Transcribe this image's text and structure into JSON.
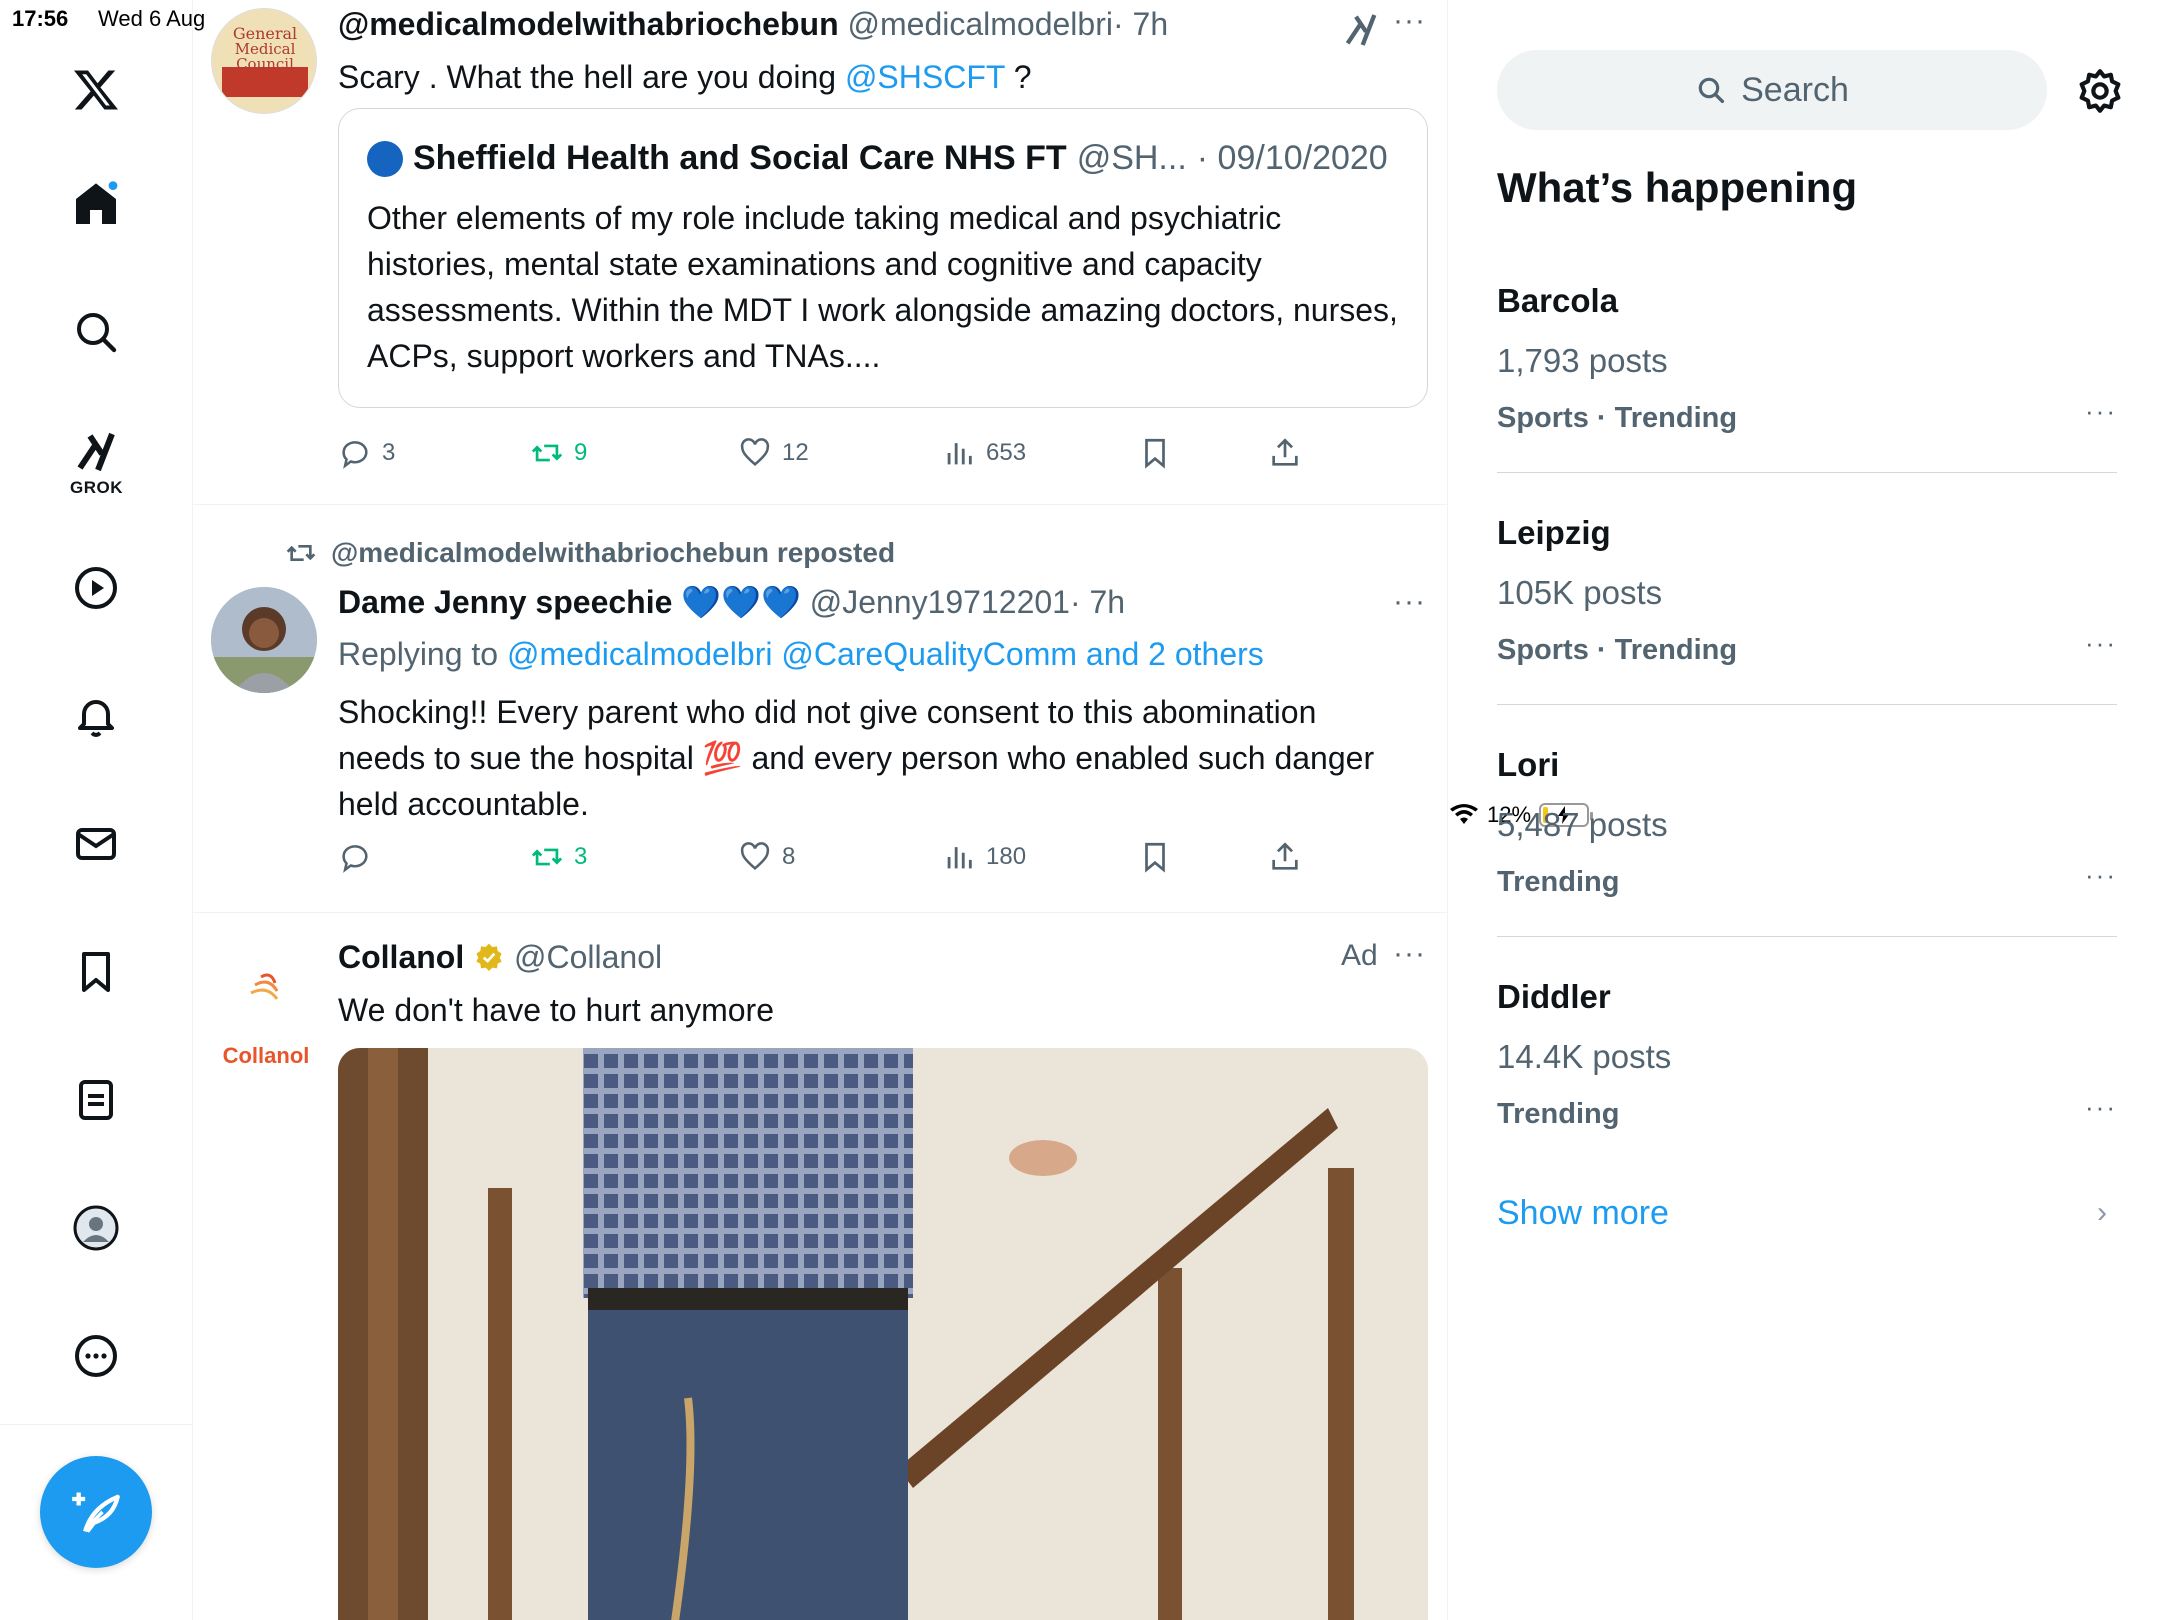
{
  "status_bar": {
    "time": "17:56",
    "date": "Wed 6 Aug",
    "battery": "12%",
    "battery_level": 0.12
  },
  "nav": {
    "grok_label": "GROK",
    "items": [
      "home-icon",
      "search-icon",
      "grok-icon",
      "video-icon",
      "notifications-icon",
      "messages-icon",
      "bookmarks-icon",
      "lists-icon",
      "profile-icon",
      "more-icon"
    ]
  },
  "tweets": [
    {
      "name": "@medicalmodelwithabriochebun",
      "handle": "@medicalmodelbri",
      "time": "· 7h",
      "text_before": "Scary . What the hell are you doing ",
      "mention": "@SHSCFT",
      "text_after": " ?",
      "quote": {
        "name": "Sheffield Health and Social Care NHS FT",
        "handle": "@SH...",
        "date": "· 09/10/2020",
        "text": "Other elements of my role include taking medical and psychiatric histories, mental state examinations and cognitive and capacity assessments. Within the MDT I work alongside amazing doctors, nurses, ACPs, support workers and TNAs...."
      },
      "replies": "3",
      "reposts": "9",
      "likes": "12",
      "views": "653"
    },
    {
      "repost_by": "@medicalmodelwithabriochebun reposted",
      "name": "Dame Jenny speechie",
      "emojis": "💙💙💙",
      "handle": "@Jenny19712201",
      "time": "· 7h",
      "replying_label": "Replying to ",
      "replying_to": "@medicalmodelbri @CareQualityComm and 2 others",
      "text_before": "Shocking!! Every parent who did not give consent to this abomination needs to sue the hospital ",
      "emoji_100": "💯",
      "text_after": " and every person who enabled such danger held accountable.",
      "replies": "",
      "reposts": "3",
      "likes": "8",
      "views": "180"
    },
    {
      "name": "Collanol",
      "handle": "@Collanol",
      "ad_label": "Ad",
      "logo_text": "Collanol",
      "text": "We don't have to hurt anymore"
    }
  ],
  "sidebar": {
    "search_placeholder": "Search",
    "heading": "What’s happening",
    "trends": [
      {
        "name": "Barcola",
        "count": "1,793 posts",
        "category": "Sports · Trending"
      },
      {
        "name": "Leipzig",
        "count": "105K posts",
        "category": "Sports · Trending"
      },
      {
        "name": "Lori",
        "count": "5,487 posts",
        "category": "Trending"
      },
      {
        "name": "Diddler",
        "count": "14.4K posts",
        "category": "Trending"
      }
    ],
    "show_more": "Show more"
  }
}
